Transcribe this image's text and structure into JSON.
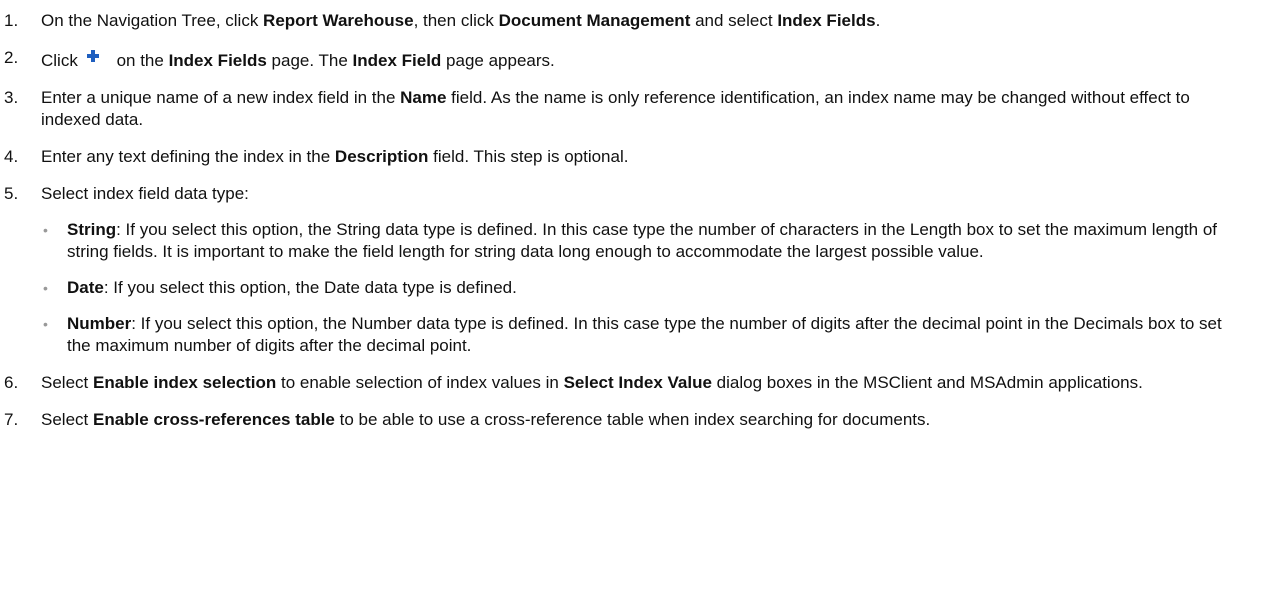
{
  "steps": [
    {
      "num": "1.",
      "parts": [
        "On the Navigation Tree, click ",
        "Report Warehouse",
        ", then click ",
        "Document Management",
        " and select ",
        "Index Fields",
        "."
      ]
    },
    {
      "num": "2.",
      "parts": [
        "Click",
        " on the ",
        "Index Fields",
        " page. The ",
        "Index Field",
        " page appears."
      ],
      "icon": "plus-icon"
    },
    {
      "num": "3.",
      "parts": [
        "Enter a unique name of a new index field in the ",
        "Name",
        " field. As the name is only reference identification, an index name may be changed without effect to indexed data."
      ]
    },
    {
      "num": "4.",
      "parts": [
        "Enter any text defining the index in the ",
        "Description",
        " field. This step is optional."
      ]
    },
    {
      "num": "5.",
      "text": "Select index field data type:",
      "bullets": [
        {
          "term": "String",
          "text": ": If you select this option, the String data type is defined. In this case type the number of characters in the Length box to set the maximum length of string fields. It is important to make the field length for string data long enough to accommodate the largest possible value."
        },
        {
          "term": "Date",
          "text": ": If you select this option, the Date data type is defined."
        },
        {
          "term": "Number",
          "text": ": If you select this option, the Number data type is defined. In this case  type the number of digits after the decimal point in the Decimals box to set the maximum number of digits after the decimal point."
        }
      ]
    },
    {
      "num": "6.",
      "parts": [
        " Select ",
        "Enable index selection",
        " to  enable selection of index values in ",
        "Select Index Value",
        " dialog boxes in the MSClient and MSAdmin applications."
      ]
    },
    {
      "num": "7.",
      "parts": [
        "Select ",
        "Enable cross-references table",
        " to be able to use a cross-reference table when index searching for documents."
      ]
    }
  ],
  "bullet_char": "•"
}
